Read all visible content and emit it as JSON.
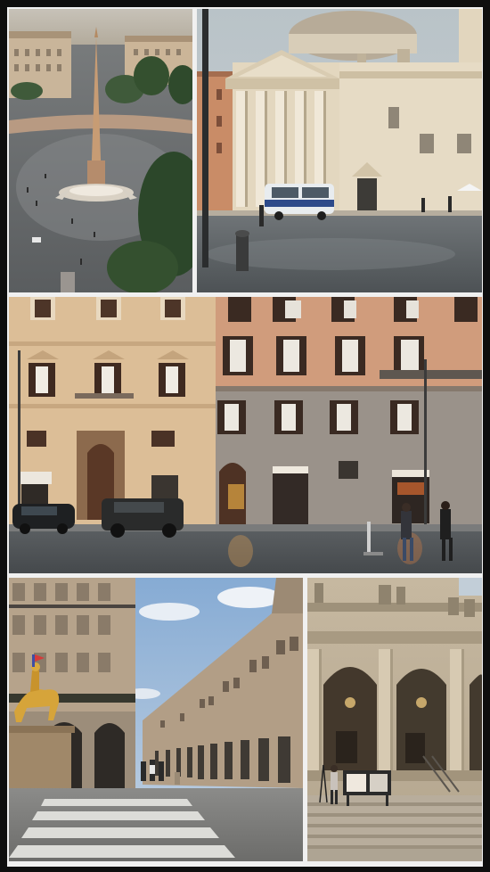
{
  "collage": {
    "panels": [
      {
        "id": "piazza-del-popolo-obelisk",
        "description_icon": "photo-icon"
      },
      {
        "id": "church-facade-police-van",
        "description_icon": "photo-icon"
      },
      {
        "id": "street-buildings-wet-road",
        "description_icon": "photo-icon"
      },
      {
        "id": "golden-statue-street-arcade",
        "description_icon": "photo-icon"
      },
      {
        "id": "neoclassical-library-facade",
        "description_icon": "photo-icon"
      }
    ]
  },
  "colors": {
    "border": "#f2f2f2",
    "outer": "#0e0e0e",
    "sky": "#b9c6cf",
    "wet_pavement": "#5d6367",
    "ochre_building": "#d9b98f",
    "stone": "#cdbfa6"
  }
}
